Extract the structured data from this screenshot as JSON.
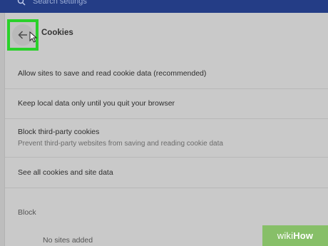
{
  "search": {
    "placeholder": "Search settings"
  },
  "header": {
    "title": "Cookies"
  },
  "settings": {
    "allow": "Allow sites to save and read cookie data (recommended)",
    "keep_local": "Keep local data only until you quit your browser",
    "block_third_party": "Block third-party cookies",
    "block_third_party_desc": "Prevent third-party websites from saving and reading cookie data",
    "see_all": "See all cookies and site data"
  },
  "block_section": {
    "label": "Block",
    "empty_text": "No sites added"
  },
  "watermark": {
    "part1": "wiki",
    "part2": "How"
  },
  "colors": {
    "highlight": "#2ad12a",
    "topbar": "#243d86",
    "watermark": "#87bf68"
  }
}
